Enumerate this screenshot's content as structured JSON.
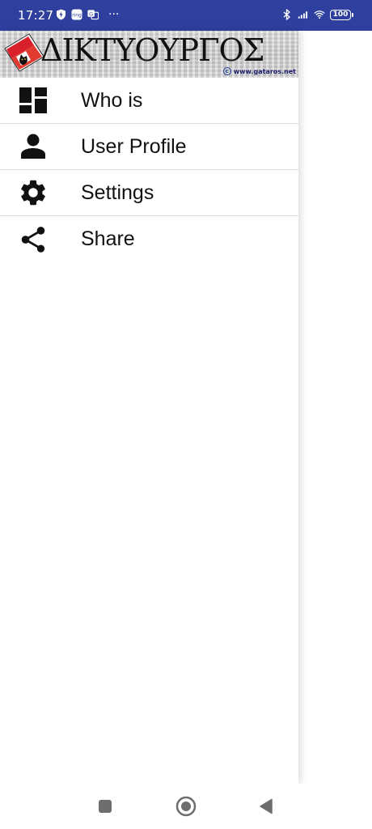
{
  "status_bar": {
    "time": "17:27",
    "left_icons": [
      "bolt-shield-icon",
      "ring-app-icon",
      "translate-app-icon"
    ],
    "overflow": "···",
    "right_icons": [
      "bluetooth-icon",
      "signal-icon",
      "wifi-icon"
    ],
    "battery_level": "100",
    "background": "#2e3f9e"
  },
  "drawer": {
    "header": {
      "title": "ΔΙΚΤΥΟΥΡΓΟΣ",
      "credit": "www.gataros.net",
      "copyright": "c"
    },
    "items": [
      {
        "label": "Who is",
        "icon": "dashboard-icon"
      },
      {
        "label": "User Profile",
        "icon": "person-icon"
      },
      {
        "label": "Settings",
        "icon": "gear-icon"
      },
      {
        "label": "Share",
        "icon": "share-icon"
      }
    ]
  },
  "nav_bar": {
    "buttons": [
      "recents-square-icon",
      "home-circle-icon",
      "back-triangle-icon"
    ]
  },
  "colors": {
    "status_bar": "#2e3f9e",
    "text": "#111111",
    "divider": "#dddddd",
    "logo_red": "#d9202a"
  }
}
